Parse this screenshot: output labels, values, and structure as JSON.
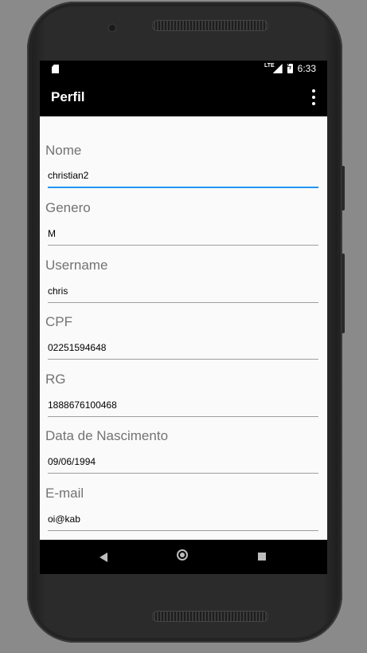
{
  "status_bar": {
    "network": "LTE",
    "time": "6:33"
  },
  "toolbar": {
    "title": "Perfil"
  },
  "fields": [
    {
      "label": "Nome",
      "value": "christian2"
    },
    {
      "label": "Genero",
      "value": "M"
    },
    {
      "label": "Username",
      "value": "chris"
    },
    {
      "label": "CPF",
      "value": "02251594648"
    },
    {
      "label": "RG",
      "value": "1888676100468"
    },
    {
      "label": "Data de Nascimento",
      "value": "09/06/1994"
    },
    {
      "label": "E-mail",
      "value": "oi@kab"
    }
  ],
  "colors": {
    "accent": "#2196f3",
    "label": "#737373",
    "toolbar": "#000000",
    "screen_bg": "#fafafa"
  }
}
